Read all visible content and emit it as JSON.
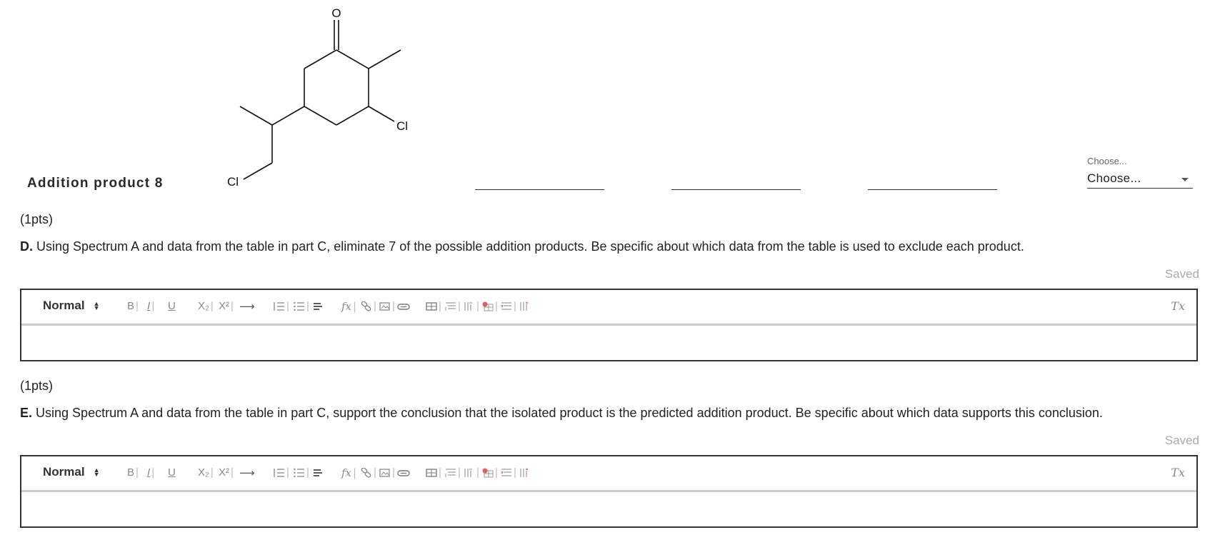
{
  "product": {
    "label": "Addition product 8",
    "atoms": {
      "oxygen": "O",
      "chlorine_ring": "Cl",
      "chlorine_chain": "Cl"
    }
  },
  "select": {
    "caption": "Choose...",
    "value": "Choose..."
  },
  "questions": [
    {
      "points": "(1pts)",
      "letter": "D.",
      "text": "Using Spectrum A and data from the table in part C, eliminate 7 of the possible addition products. Be specific about which data from the table is used to exclude each product.",
      "saved": "Saved",
      "format": "Normal"
    },
    {
      "points": "(1pts)",
      "letter": "E.",
      "text": "Using Spectrum A and data from the table in part C, support the conclusion that the isolated product is the predicted addition product. Be specific about which data supports this conclusion.",
      "saved": "Saved",
      "format": "Normal"
    }
  ],
  "toolbar": {
    "bold": "B",
    "italic": "I",
    "underline": "U",
    "subscript": "X₂",
    "superscript": "X²",
    "arrow": "⟶",
    "formula": "fx",
    "clear": "Tx"
  }
}
